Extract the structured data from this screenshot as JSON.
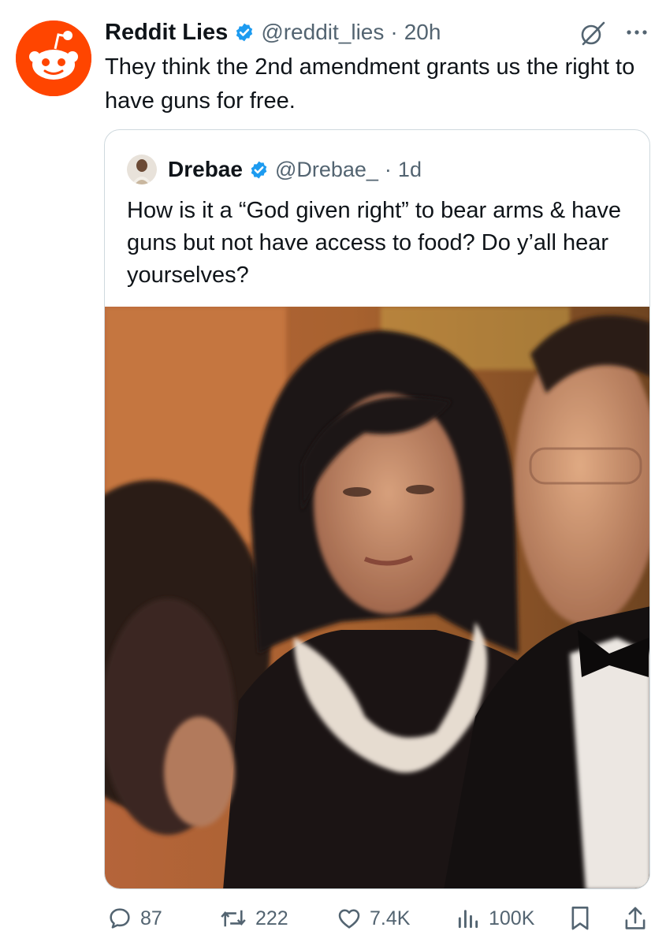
{
  "tweet": {
    "author_name": "Reddit Lies",
    "author_handle": "@reddit_lies",
    "separator": "·",
    "time": "20h",
    "text": "They think the 2nd amendment grants us the right to have guns for free.",
    "avatar_icon": "reddit-alien-icon",
    "verified_icon": "verified-badge-icon",
    "more_icon": "more-options-icon",
    "grok_icon": "grok-icon"
  },
  "quote": {
    "author_name": "Drebae",
    "author_handle": "@Drebae_",
    "separator": "·",
    "time": "1d",
    "text": "How is it a “God given right” to bear arms & have guns but not have access to food? Do y’all hear yourselves?",
    "media_icon": "photo-image"
  },
  "actions": {
    "reply_count": "87",
    "repost_count": "222",
    "like_count": "7.4K",
    "view_count": "100K",
    "reply_icon": "reply-icon",
    "repost_icon": "repost-icon",
    "like_icon": "heart-icon",
    "views_icon": "views-chart-icon",
    "bookmark_icon": "bookmark-icon",
    "share_icon": "share-icon"
  },
  "colors": {
    "reddit_orange": "#ff4500",
    "verified_blue": "#1d9bf0",
    "secondary_text": "#536471",
    "primary_text": "#0f1419",
    "border": "#cfd9de"
  }
}
